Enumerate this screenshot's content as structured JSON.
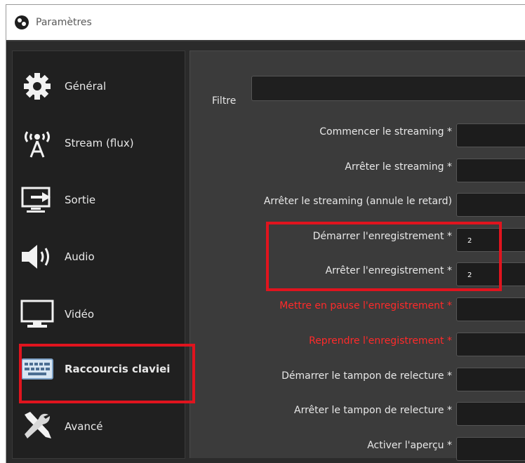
{
  "window": {
    "title": "Paramètres"
  },
  "sidebar": {
    "items": [
      {
        "label": "Général",
        "icon": "gear-icon"
      },
      {
        "label": "Stream (flux)",
        "icon": "broadcast-antenna-icon"
      },
      {
        "label": "Sortie",
        "icon": "output-arrow-icon"
      },
      {
        "label": "Audio",
        "icon": "speaker-icon"
      },
      {
        "label": "Vidéo",
        "icon": "monitor-icon"
      },
      {
        "label": "Raccourcis claviei",
        "icon": "keyboard-icon"
      },
      {
        "label": "Avancé",
        "icon": "wrench-screwdriver-icon"
      }
    ]
  },
  "hotkeys": {
    "filter_label": "Filtre",
    "filter_value": "",
    "rows": [
      {
        "label": "Commencer le streaming *",
        "value": ""
      },
      {
        "label": "Arrêter le streaming *",
        "value": ""
      },
      {
        "label": "Arrêter le streaming (annule le retard)",
        "value": ""
      },
      {
        "label": "Démarrer l'enregistrement *",
        "value": "2"
      },
      {
        "label": "Arrêter l'enregistrement *",
        "value": "2"
      },
      {
        "label": "Mettre en pause l'enregistrement *",
        "value": ""
      },
      {
        "label": "Reprendre l'enregistrement *",
        "value": ""
      },
      {
        "label": "Démarrer le tampon de relecture *",
        "value": ""
      },
      {
        "label": "Arrêter le tampon de relecture *",
        "value": ""
      },
      {
        "label": "Activer l'aperçu *",
        "value": ""
      }
    ]
  },
  "colors": {
    "highlight": "#e0141e",
    "warning_text": "#ff2a2a",
    "panel_background": "#3b3b3b",
    "sidebar_background": "#202020"
  }
}
